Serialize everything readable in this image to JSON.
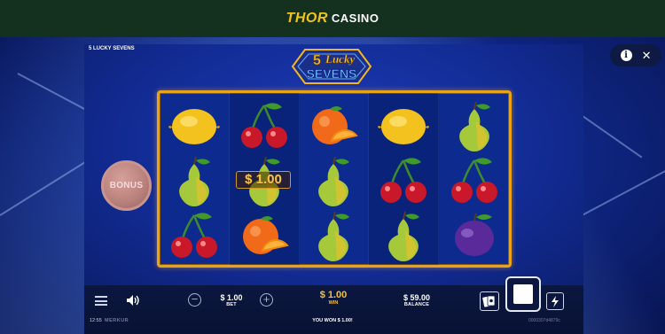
{
  "brand": {
    "name_part1": "THOR",
    "name_part2": "CASINO"
  },
  "game": {
    "title": "5 LUCKY SEVENS",
    "logo_line1": "5 Lucky",
    "logo_line2": "SEVENS",
    "reels": [
      [
        "lemon",
        "pear",
        "cherry"
      ],
      [
        "cherry",
        "pear",
        "orange"
      ],
      [
        "orange",
        "pear",
        "pear"
      ],
      [
        "lemon",
        "cherry",
        "pear"
      ],
      [
        "pear",
        "cherry",
        "plum"
      ]
    ],
    "win_line_label": "$ 1.00",
    "bonus_label": "BONUS"
  },
  "controls": {
    "menu_icon": "hamburger-icon",
    "sound_icon": "speaker-icon",
    "bet_value": "$ 1.00",
    "bet_caption": "BET",
    "win_value": "$ 1.00",
    "win_caption": "WIN",
    "balance_value": "$ 59.00",
    "balance_caption": "BALANCE",
    "minus_symbol": "−",
    "plus_symbol": "+"
  },
  "status": {
    "clock": "12:55",
    "maker": "MERKUR",
    "message": "YOU WON $ 1.00!",
    "round_id": "0000307d4879c"
  },
  "colors": {
    "accent_gold": "#f7c42b",
    "reel_border": "#e8a31a",
    "topbar": "#14301f"
  }
}
